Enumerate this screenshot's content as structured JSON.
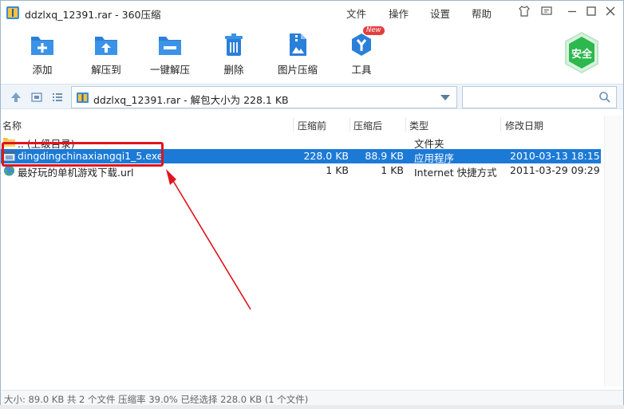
{
  "window": {
    "title": "ddzlxq_12391.rar - 360压缩",
    "menus": [
      "文件",
      "操作",
      "设置",
      "帮助"
    ]
  },
  "toolbar": {
    "items": [
      {
        "label": "添加",
        "icon": "add-icon"
      },
      {
        "label": "解压到",
        "icon": "extract-to-icon"
      },
      {
        "label": "一键解压",
        "icon": "one-click-extract-icon"
      },
      {
        "label": "删除",
        "icon": "delete-icon"
      },
      {
        "label": "图片压缩",
        "icon": "image-compress-icon"
      },
      {
        "label": "工具",
        "icon": "tools-icon"
      }
    ],
    "new_badge": "New",
    "safe_label": "安全"
  },
  "address": {
    "text": "ddzlxq_12391.rar - 解包大小为 228.1 KB",
    "search_placeholder": ""
  },
  "list": {
    "columns": [
      "名称",
      "压缩前",
      "压缩后",
      "类型",
      "修改日期"
    ],
    "rows": [
      {
        "name": ".. (上级目录)",
        "before": "",
        "after": "",
        "type": "文件夹",
        "date": "",
        "icon": "folder-icon",
        "selected": false
      },
      {
        "name": "dingdingchinaxiangqi1_5.exe",
        "before": "228.0 KB",
        "after": "88.9 KB",
        "type": "应用程序",
        "date": "2010-03-13 18:15",
        "icon": "exe-file-icon",
        "selected": true
      },
      {
        "name": "最好玩的单机游戏下载.url",
        "before": "1 KB",
        "after": "1 KB",
        "type": "Internet 快捷方式",
        "date": "2011-03-29 09:29",
        "icon": "internet-shortcut-icon",
        "selected": false
      }
    ]
  },
  "status": {
    "text": "大小: 89.0 KB 共 2 个文件 压缩率 39.0% 已经选择 228.0 KB (1 个文件)"
  },
  "colors": {
    "accent": "#1c7ad6",
    "annotation": "#e0141e",
    "safe_green": "#2db84d"
  }
}
